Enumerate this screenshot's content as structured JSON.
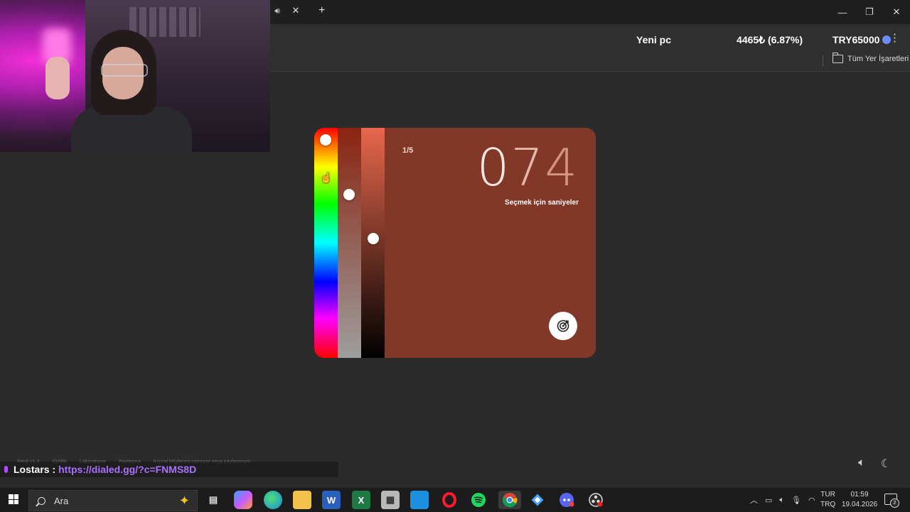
{
  "browser": {
    "tab_icon": "speaker-icon",
    "bookmarks_label": "Tüm Yer İşaretleri"
  },
  "stream_goal": {
    "name": "Yeni pc",
    "amount": "4465₺ (6.87%)",
    "target": "TRY65000"
  },
  "game": {
    "round": "1/5",
    "timer_digits": [
      "0",
      "7",
      "4"
    ],
    "timer_caption": "Seçmek için saniyeler",
    "hue_level": 0.03,
    "saturation_level": 0.28,
    "brightness_level": 0.48,
    "colors": {
      "card": "#823828",
      "submit": "#ffffff"
    }
  },
  "overlay": {
    "faint_items": [
      "Renk v1.4",
      "Gizlilik",
      "Laboratuvar",
      "Paylaşma",
      "Kişisel bilgilerimi satmıyor veya paylaşmıyor"
    ]
  },
  "chat": {
    "username": "Lostars :",
    "message": "https://dialed.gg/?c=FNMS8D"
  },
  "taskbar": {
    "search_placeholder": "Ara",
    "lang_line1": "TUR",
    "lang_line2": "TRQ",
    "time": "01:59",
    "date": "19.04.2026",
    "notification_count": "2"
  }
}
